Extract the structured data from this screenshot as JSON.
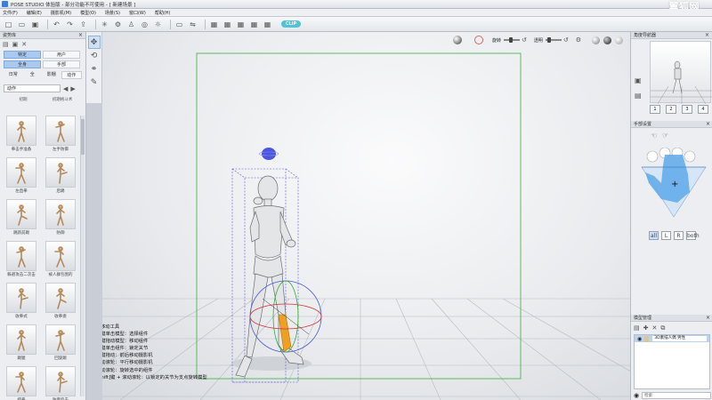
{
  "window": {
    "title": "POSE STUDIO 体验版 - 部分功能不可使用 - [ 新建场景 ]",
    "watermark": "翼狐网"
  },
  "menu": [
    "文件(F)",
    "编辑(E)",
    "摄影机(M)",
    "模型(O)",
    "场景(S)",
    "窗口(W)",
    "帮助(H)"
  ],
  "toolbar": {
    "icons": [
      "new-icon",
      "open-icon",
      "save-icon",
      "undo-icon",
      "redo-icon",
      "export-icon",
      "import-icon",
      "bone-icon",
      "joint-icon",
      "pose-icon",
      "ground-icon",
      "light-icon",
      "ruler-icon",
      "mirror-icon",
      "layout-1-icon",
      "layout-2-icon",
      "layout-3-icon",
      "layout-4-icon",
      "layout-5-icon"
    ],
    "badge": "CLIP"
  },
  "left_panel": {
    "title": "姿势库",
    "tabs_top": [
      "特定",
      "用户"
    ],
    "tabs_mid": [
      "全身",
      "手部"
    ],
    "subtabs": [
      "日常",
      "全",
      "影棚",
      "动作"
    ],
    "category": "动作",
    "column_headers": [
      "初期",
      "初期格斗术"
    ],
    "thumbnails": [
      {
        "label": "拳击手准备"
      },
      {
        "label": "左手防御"
      },
      {
        "label": "左直拳"
      },
      {
        "label": "后踢"
      },
      {
        "label": "跳跃前踢"
      },
      {
        "label": "防御"
      },
      {
        "label": "躲避攻击二次击"
      },
      {
        "label": "被人群包围的"
      },
      {
        "label": "收拳式"
      },
      {
        "label": "收拳姿"
      },
      {
        "label": "踢腿"
      },
      {
        "label": "回旋踢"
      },
      {
        "label": "摆拳"
      },
      {
        "label": "防御反击"
      }
    ]
  },
  "viewport": {
    "controls": {
      "rotate_label": "旋转",
      "opacity_label": "透明"
    },
    "help": {
      "title": "■移动工具",
      "lines": [
        "左键单击模型：选择组件",
        "左键拖动模型：移动组件",
        "右键单击组件：锁定关节",
        "右键拖动：前后移动摄影机",
        "拖动滚轮：平行移动摄影机",
        "滚动滚轮：旋转选中的组件",
        "[Shift]键 + 滚动滚轮：以锁定的关节为支点旋转模型"
      ]
    }
  },
  "right_panel": {
    "camera_title": "角度导航器",
    "camera_buttons": [
      "1",
      "2",
      "3",
      "4"
    ],
    "hand_title": "手部设置",
    "hand_buttons": [
      "all",
      "L",
      "R",
      "both"
    ],
    "model_title": "模型管理",
    "model_row_name": "3D素描人偶 男性",
    "search_placeholder": "检索"
  },
  "colors": {
    "selection_box": "#5a5ad6",
    "grid_border": "#3cae3c",
    "highlight_leg": "#f0a020",
    "accent_blue": "#a9c9ef"
  }
}
